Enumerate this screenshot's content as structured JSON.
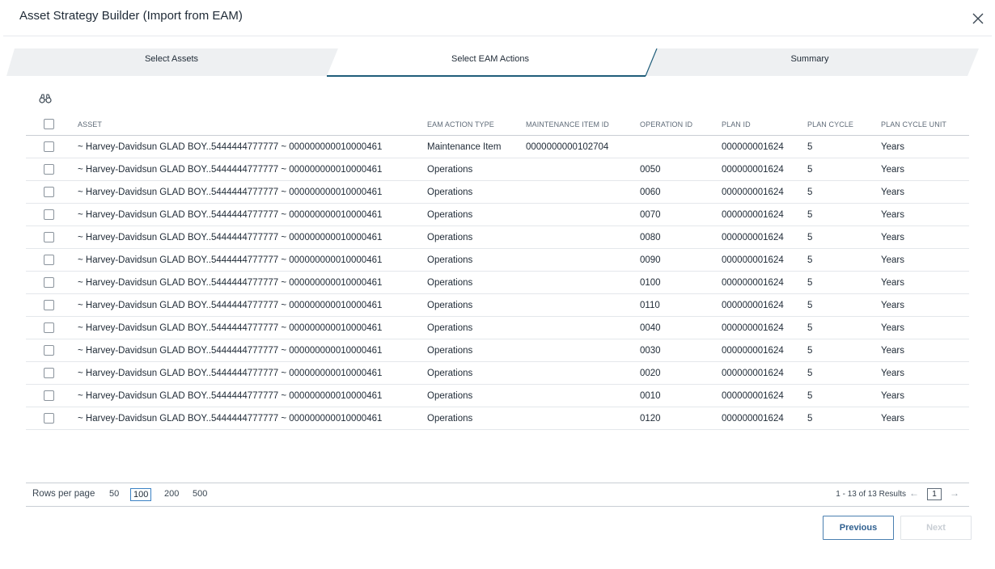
{
  "dialog": {
    "title": "Asset Strategy Builder (Import from EAM)"
  },
  "stepper": {
    "steps": [
      {
        "label": "Select Assets"
      },
      {
        "label": "Select EAM Actions"
      },
      {
        "label": "Summary"
      }
    ],
    "active_step": "Select EAM Actions"
  },
  "toolbar": {
    "icon": "binoculars-icon"
  },
  "grid": {
    "columns": {
      "asset": "ASSET",
      "type": "EAM ACTION TYPE",
      "mid": "MAINTENANCE ITEM ID",
      "op": "OPERATION ID",
      "plan": "PLAN ID",
      "cycle": "PLAN CYCLE",
      "unit": "PLAN CYCLE UNIT"
    },
    "rows": [
      {
        "asset": "~ Harvey-Davidsun GLAD BOY..5444444777777 ~ 000000000010000461",
        "type": "Maintenance Item",
        "mid": "0000000000102704",
        "op": "",
        "plan": "000000001624",
        "cycle": "5",
        "unit": "Years"
      },
      {
        "asset": "~ Harvey-Davidsun GLAD BOY..5444444777777 ~ 000000000010000461",
        "type": "Operations",
        "mid": "",
        "op": "0050",
        "plan": "000000001624",
        "cycle": "5",
        "unit": "Years"
      },
      {
        "asset": "~ Harvey-Davidsun GLAD BOY..5444444777777 ~ 000000000010000461",
        "type": "Operations",
        "mid": "",
        "op": "0060",
        "plan": "000000001624",
        "cycle": "5",
        "unit": "Years"
      },
      {
        "asset": "~ Harvey-Davidsun GLAD BOY..5444444777777 ~ 000000000010000461",
        "type": "Operations",
        "mid": "",
        "op": "0070",
        "plan": "000000001624",
        "cycle": "5",
        "unit": "Years"
      },
      {
        "asset": "~ Harvey-Davidsun GLAD BOY..5444444777777 ~ 000000000010000461",
        "type": "Operations",
        "mid": "",
        "op": "0080",
        "plan": "000000001624",
        "cycle": "5",
        "unit": "Years"
      },
      {
        "asset": "~ Harvey-Davidsun GLAD BOY..5444444777777 ~ 000000000010000461",
        "type": "Operations",
        "mid": "",
        "op": "0090",
        "plan": "000000001624",
        "cycle": "5",
        "unit": "Years"
      },
      {
        "asset": "~ Harvey-Davidsun GLAD BOY..5444444777777 ~ 000000000010000461",
        "type": "Operations",
        "mid": "",
        "op": "0100",
        "plan": "000000001624",
        "cycle": "5",
        "unit": "Years"
      },
      {
        "asset": "~ Harvey-Davidsun GLAD BOY..5444444777777 ~ 000000000010000461",
        "type": "Operations",
        "mid": "",
        "op": "0110",
        "plan": "000000001624",
        "cycle": "5",
        "unit": "Years"
      },
      {
        "asset": "~ Harvey-Davidsun GLAD BOY..5444444777777 ~ 000000000010000461",
        "type": "Operations",
        "mid": "",
        "op": "0040",
        "plan": "000000001624",
        "cycle": "5",
        "unit": "Years"
      },
      {
        "asset": "~ Harvey-Davidsun GLAD BOY..5444444777777 ~ 000000000010000461",
        "type": "Operations",
        "mid": "",
        "op": "0030",
        "plan": "000000001624",
        "cycle": "5",
        "unit": "Years"
      },
      {
        "asset": "~ Harvey-Davidsun GLAD BOY..5444444777777 ~ 000000000010000461",
        "type": "Operations",
        "mid": "",
        "op": "0020",
        "plan": "000000001624",
        "cycle": "5",
        "unit": "Years"
      },
      {
        "asset": "~ Harvey-Davidsun GLAD BOY..5444444777777 ~ 000000000010000461",
        "type": "Operations",
        "mid": "",
        "op": "0010",
        "plan": "000000001624",
        "cycle": "5",
        "unit": "Years"
      },
      {
        "asset": "~ Harvey-Davidsun GLAD BOY..5444444777777 ~ 000000000010000461",
        "type": "Operations",
        "mid": "",
        "op": "0120",
        "plan": "000000001624",
        "cycle": "5",
        "unit": "Years"
      }
    ]
  },
  "pager": {
    "rows_per_page_label": "Rows per page",
    "options": [
      "50",
      "100",
      "200",
      "500"
    ],
    "selected": "100",
    "results_text": "1 - 13 of 13 Results",
    "current_page": "1",
    "prev_icon": "arrow-left-icon",
    "next_icon": "arrow-right-icon"
  },
  "footer": {
    "previous_label": "Previous",
    "next_label": "Next"
  },
  "colors": {
    "accent": "#1f5d7a",
    "button_border": "#4a7fb0",
    "tab_inactive": "#eef0f2"
  }
}
